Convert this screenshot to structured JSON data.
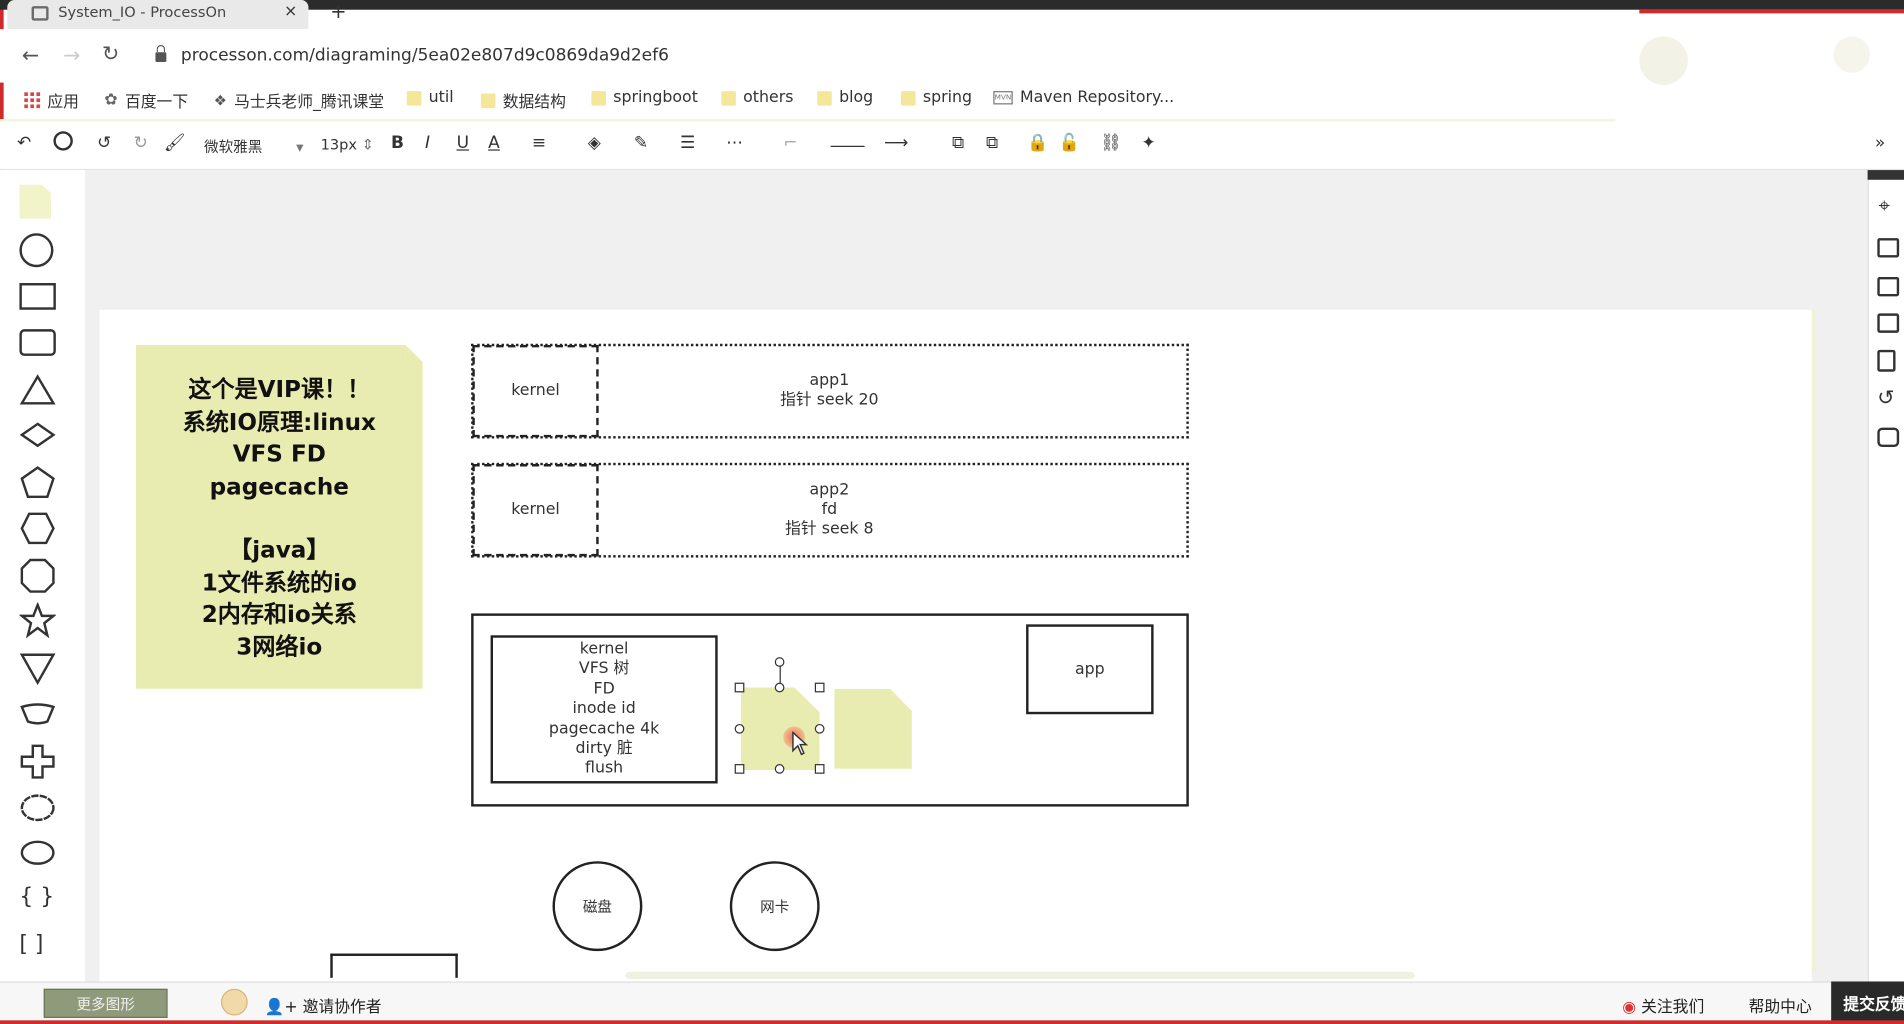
{
  "browser": {
    "tab_title": "System_IO - ProcessOn",
    "tab_close": "×",
    "tab_new": "+",
    "url": "processon.com/diagraming/5ea02e807d9c0869da9d2ef6",
    "back": "←",
    "forward": "→",
    "reload": "↻"
  },
  "bookmarks": [
    {
      "label": "应用"
    },
    {
      "label": "百度一下"
    },
    {
      "label": "马士兵老师_腾讯课堂"
    },
    {
      "label": "util"
    },
    {
      "label": "数据结构"
    },
    {
      "label": "springboot"
    },
    {
      "label": "others"
    },
    {
      "label": "blog"
    },
    {
      "label": "spring"
    },
    {
      "label": "Maven Repository..."
    }
  ],
  "toolbar": {
    "font_family": "微软雅黑",
    "font_size": "13px",
    "bold": "B",
    "italic": "I",
    "underline": "U",
    "font_color": "A",
    "collapse": "»"
  },
  "diagram": {
    "vip_note": {
      "lines": [
        "这个是VIP课！！",
        "系统IO原理:linux",
        "VFS FD",
        "pagecache",
        "",
        "【java】",
        "1文件系统的io",
        "2内存和io关系",
        "3网络io"
      ]
    },
    "row1": {
      "kernel": "kernel",
      "app_lines": [
        "app1",
        "指针 seek 20"
      ]
    },
    "row2": {
      "kernel": "kernel",
      "app_lines": [
        "app2",
        "fd",
        "指针 seek  8"
      ]
    },
    "kernel_box_lines": [
      "kernel",
      "VFS 树",
      "FD",
      "inode id",
      "pagecache 4k",
      "dirty  脏",
      "flush"
    ],
    "app_box": "app",
    "disk": "磁盘",
    "nic": "网卡"
  },
  "bottom": {
    "zoom_label": "更多图形",
    "invite": "邀请协作者",
    "follow": "关注我们",
    "help": "帮助中心",
    "feedback": "提交反馈"
  }
}
